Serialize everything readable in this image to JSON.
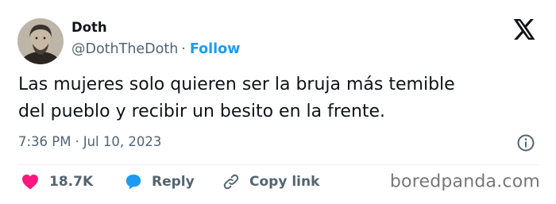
{
  "author": {
    "name": "Doth",
    "handle": "@DothTheDoth",
    "separator": "·",
    "follow_label": "Follow"
  },
  "tweet": {
    "text_line1": "Las mujeres solo quieren ser la bruja más temible",
    "text_line2": "del pueblo y recibir un besito en la frente.",
    "time": "7:36 PM",
    "separator": "·",
    "date": "Jul 10, 2023"
  },
  "actions": {
    "likes_count": "18.7K",
    "reply_label": "Reply",
    "copy_link_label": "Copy link"
  },
  "watermark": "boredpanda.com",
  "icons": {
    "platform": "x-logo-icon",
    "info": "info-icon",
    "like": "heart-icon",
    "reply": "speech-bubble-icon",
    "copy": "link-icon"
  },
  "colors": {
    "accent": "#1d9bf0",
    "heart": "#f91880",
    "text": "#0f1419",
    "muted": "#536471"
  }
}
